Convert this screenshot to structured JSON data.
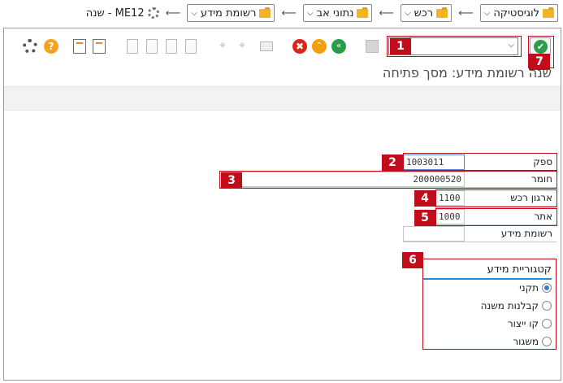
{
  "breadcrumb": {
    "items": [
      "לוגיסטיקה",
      "רכש",
      "נתוני אב",
      "רשומת מידע"
    ],
    "tcode": "ME12 - שנה"
  },
  "toolbar": {
    "command_value": "",
    "help_glyph": "?",
    "cancel_glyph": "✖",
    "up_glyph": "⌃",
    "back_glyph": "«",
    "ok_glyph": "✔",
    "binoculars_glyph": "⌖"
  },
  "title": "שנה רשומת מידע: מסך פתיחה",
  "form": {
    "vendor": {
      "label": "ספק",
      "value": "1003011"
    },
    "material": {
      "label": "חומר",
      "value": "200000520"
    },
    "purch_org": {
      "label": "ארגון רכש",
      "value": "1100"
    },
    "plant": {
      "label": "אתר",
      "value": "1000"
    },
    "info_record": {
      "label": "רשומת מידע",
      "value": ""
    }
  },
  "category": {
    "title": "קטגוריית מידע",
    "options": [
      "תקני",
      "קבלנות משנה",
      "קו ייצור",
      "משגור"
    ],
    "selected": "תקני"
  },
  "callouts": [
    "1",
    "2",
    "3",
    "4",
    "5",
    "6",
    "7"
  ],
  "colors": {
    "callout_red": "#c00c1b",
    "accent_blue": "#1e90d9",
    "ok_green": "#2a9d48"
  }
}
